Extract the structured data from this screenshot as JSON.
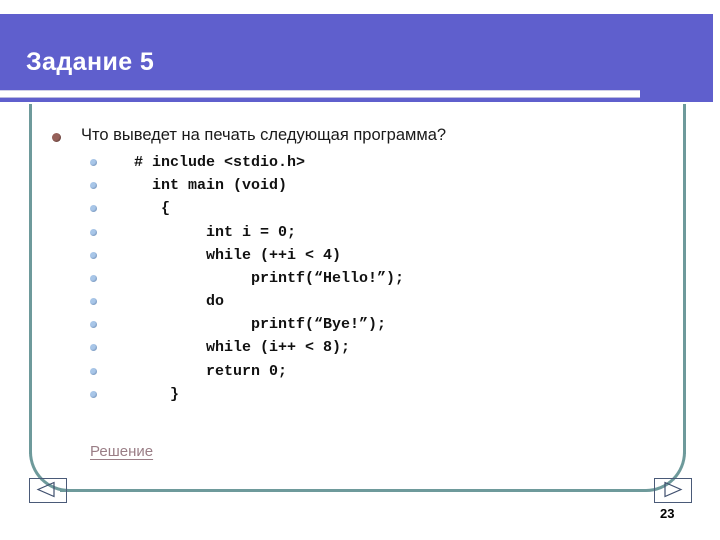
{
  "slide": {
    "title": "Задание 5",
    "page_number": "23",
    "colors": {
      "header_purple": "#5f5fcd",
      "frame_teal": "#6e9a9b",
      "bullet_l1": "#96615a",
      "bullet_l2": "#a8c6e8",
      "link_mauve": "#9a7e86",
      "title_text": "#ffffff",
      "body_text": "#1a1a1a",
      "background": "#ffffff"
    }
  },
  "content": {
    "question": "Что выведет на печать следующая программа?",
    "code_lines": [
      "   # include <stdio.h>",
      "     int main (void)",
      "      {",
      "           int i = 0;",
      "           while (++i < 4)",
      "                printf(“Hello!”);",
      "           do",
      "                printf(“Bye!”);",
      "           while (i++ < 8);",
      "           return 0;",
      "       }"
    ]
  },
  "footer": {
    "solution_link": "Решение",
    "prev_label": "",
    "next_label": ""
  },
  "icons": {
    "prev": "triangle-left-icon",
    "next": "triangle-right-icon",
    "bullet_primary": "bullet-dot-icon",
    "bullet_secondary": "bullet-dot-small-icon"
  }
}
